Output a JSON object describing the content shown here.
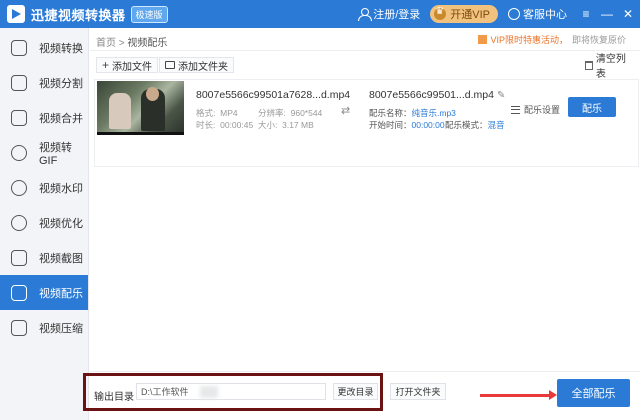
{
  "titlebar": {
    "app_title": "迅捷视频转换器",
    "edition": "极速版",
    "login": "注册/登录",
    "vip": "开通VIP",
    "service": "客服中心",
    "window_controls": [
      "≡",
      "—",
      "✕"
    ]
  },
  "sidebar": {
    "items": [
      {
        "label": "视频转换",
        "icon": "convert-icon"
      },
      {
        "label": "视频分割",
        "icon": "split-icon"
      },
      {
        "label": "视频合并",
        "icon": "merge-icon"
      },
      {
        "label": "视频转GIF",
        "icon": "gif-icon"
      },
      {
        "label": "视频水印",
        "icon": "watermark-icon"
      },
      {
        "label": "视频优化",
        "icon": "optimize-icon"
      },
      {
        "label": "视频截图",
        "icon": "screenshot-icon"
      },
      {
        "label": "视频配乐",
        "icon": "music-icon",
        "active": true
      },
      {
        "label": "视频压缩",
        "icon": "compress-icon"
      }
    ]
  },
  "main": {
    "breadcrumb": {
      "home": "首页",
      "sep": ">",
      "current": "视频配乐"
    },
    "promo": {
      "text": "VIP限时特惠活动，",
      "link": "即将恢复原价"
    },
    "toolbar": {
      "add_file": "添加文件",
      "add_folder": "添加文件夹",
      "clear_list": "清空列表"
    },
    "file": {
      "source_name": "8007e5566c99501a7628...d.mp4",
      "format_label": "格式:",
      "format_value": "MP4",
      "resolution_label": "分辨率:",
      "resolution_value": "960*544",
      "duration_label": "时长:",
      "duration_value": "00:00:45",
      "size_label": "大小:",
      "size_value": "3.17 MB",
      "output_name": "8007e5566c99501...d.mp4",
      "music_name_label": "配乐名称：",
      "music_name_value": "纯音乐.mp3",
      "start_time_label": "开始时间：",
      "start_time_value": "00:00:00",
      "mode_label": "配乐模式：",
      "mode_value": "混音",
      "settings": "配乐设置",
      "dub_button": "配乐"
    }
  },
  "bottom": {
    "output_label": "输出目录",
    "output_path": "D:\\工作软件",
    "change_dir": "更改目录",
    "open_folder": "打开文件夹",
    "all_dub": "全部配乐"
  },
  "colors": {
    "accent": "#2b7bd6",
    "vip": "#f1c27d",
    "highlight_frame": "#6b1212",
    "arrow": "#e83a3a",
    "promo": "#e8742a"
  }
}
